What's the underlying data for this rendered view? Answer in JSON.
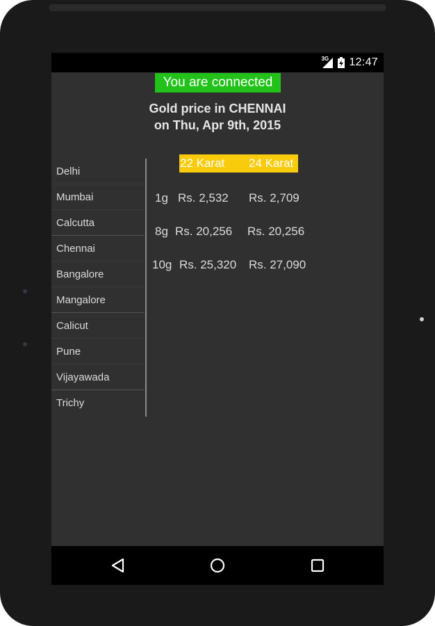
{
  "status_bar": {
    "network": "3G",
    "time": "12:47"
  },
  "banner": {
    "text": "You are connected",
    "color": "#22c21a"
  },
  "title": {
    "line1": "Gold price in CHENNAI",
    "line2": "on  Thu, Apr 9th, 2015"
  },
  "cities": [
    {
      "label": "Delhi"
    },
    {
      "label": "Mumbai"
    },
    {
      "label": "Calcutta"
    },
    {
      "label": "Chennai"
    },
    {
      "label": "Bangalore"
    },
    {
      "label": "Mangalore"
    },
    {
      "label": "Calicut"
    },
    {
      "label": "Pune"
    },
    {
      "label": "Vijayawada"
    },
    {
      "label": "Trichy"
    }
  ],
  "prices": {
    "header": {
      "k22": "22 Karat",
      "k24": "24 Karat",
      "color": "#f8cc0c"
    },
    "rows": [
      {
        "weight": "1g",
        "k22": "Rs. 2,532",
        "k24": "Rs. 2,709"
      },
      {
        "weight": "8g",
        "k22": "Rs. 20,256",
        "k24": "Rs. 20,256"
      },
      {
        "weight": "10g",
        "k22": "Rs. 25,320",
        "k24": "Rs. 27,090"
      }
    ]
  },
  "nav": {
    "back_icon": "back-triangle-icon",
    "home_icon": "home-circle-icon",
    "recents_icon": "recents-square-icon"
  }
}
